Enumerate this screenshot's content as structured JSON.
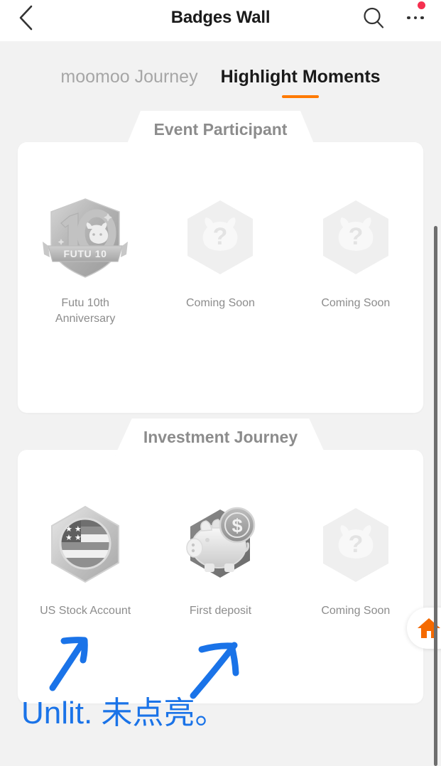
{
  "header": {
    "title": "Badges Wall",
    "back_icon": "chevron-left-icon",
    "search_icon": "search-icon",
    "more_icon": "more-horizontal-icon",
    "notification_badge": true
  },
  "tabs": [
    {
      "label": "moomoo Journey",
      "active": false
    },
    {
      "label": "Highlight Moments",
      "active": true
    }
  ],
  "sections": [
    {
      "title": "Event Participant",
      "badges": [
        {
          "label": "Futu 10th Anniversary",
          "art": "futu-10th-shield-badge",
          "unlocked": false,
          "ribbon_text": "FUTU 10"
        },
        {
          "label": "Coming Soon",
          "art": "coming-soon-hexagon-badge",
          "unlocked": false
        },
        {
          "label": "Coming Soon",
          "art": "coming-soon-hexagon-badge",
          "unlocked": false
        }
      ]
    },
    {
      "title": "Investment Journey",
      "badges": [
        {
          "label": "US Stock Account",
          "art": "us-flag-hexagon-badge",
          "unlocked": false
        },
        {
          "label": "First deposit",
          "art": "piggy-bank-hexagon-badge",
          "unlocked": false
        },
        {
          "label": "Coming Soon",
          "art": "coming-soon-hexagon-badge",
          "unlocked": false
        }
      ]
    }
  ],
  "floating_home": {
    "icon": "home-icon",
    "color": "#f56a00"
  },
  "annotation": {
    "text": "Unlit. 未点亮。",
    "color": "#1a73e8",
    "arrows": 2
  },
  "colors": {
    "accent": "#ff7a00",
    "background": "#f2f2f2",
    "card": "#ffffff",
    "label": "#8c8c8c",
    "title": "#1a1a1a",
    "notification": "#f5304f",
    "annotation": "#1a73e8",
    "scrollbar": "#6e6e6e"
  }
}
